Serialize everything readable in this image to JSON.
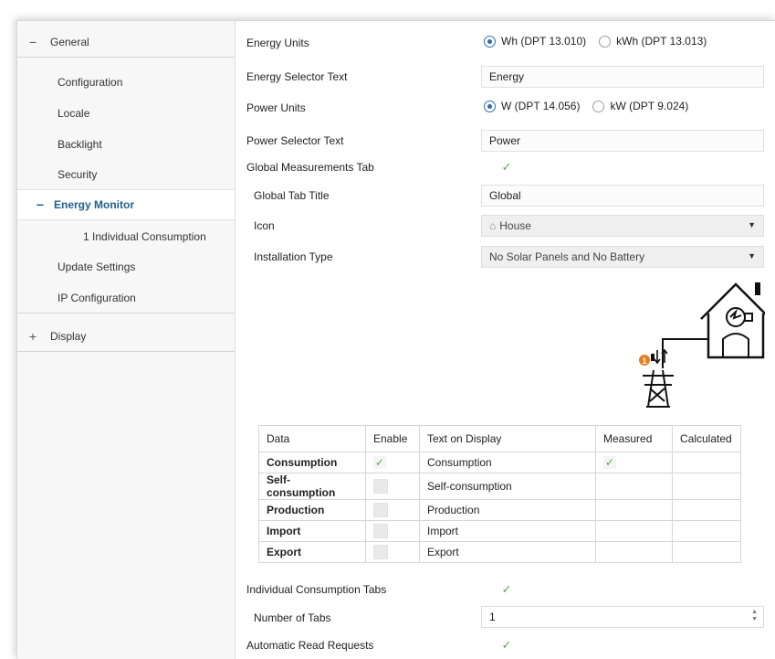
{
  "sidebar": {
    "items": [
      {
        "sign": "−",
        "label": "General"
      },
      {
        "label": "Configuration"
      },
      {
        "label": "Locale"
      },
      {
        "label": "Backlight"
      },
      {
        "label": "Security"
      },
      {
        "sign": "−",
        "label": "Energy Monitor"
      },
      {
        "label": "1 Individual Consumption"
      },
      {
        "label": "Update Settings"
      },
      {
        "label": "IP Configuration"
      },
      {
        "sign": "+",
        "label": "Display"
      }
    ]
  },
  "form": {
    "energy_units": {
      "label": "Energy Units",
      "option1": "Wh (DPT 13.010)",
      "option2": "kWh (DPT 13.013)"
    },
    "energy_selector_text": {
      "label": "Energy Selector Text",
      "value": "Energy"
    },
    "power_units": {
      "label": "Power Units",
      "option1": "W (DPT 14.056)",
      "option2": "kW (DPT 9.024)"
    },
    "power_selector_text": {
      "label": "Power Selector Text",
      "value": "Power"
    },
    "global_measurements_tab": {
      "label": "Global Measurements Tab",
      "checked": true
    },
    "global_tab_title": {
      "label": "Global Tab Title",
      "value": "Global"
    },
    "icon": {
      "label": "Icon",
      "glyph": "⌂",
      "value": "House"
    },
    "installation_type": {
      "label": "Installation Type",
      "value": "No Solar Panels and No Battery"
    },
    "individual_consumption_tabs": {
      "label": "Individual Consumption Tabs",
      "checked": true
    },
    "number_of_tabs": {
      "label": "Number of Tabs",
      "value": "1"
    },
    "automatic_read_requests": {
      "label": "Automatic Read Requests",
      "checked": true
    }
  },
  "diagram": {
    "meter_badge": "1"
  },
  "table": {
    "headers": [
      "Data",
      "Enable",
      "Text on Display",
      "Measured",
      "Calculated"
    ],
    "rows": [
      {
        "data": "Consumption",
        "enabled": true,
        "text": "Consumption",
        "measured": true
      },
      {
        "data": "Self-consumption",
        "enabled": false,
        "text": "Self-consumption",
        "measured": false
      },
      {
        "data": "Production",
        "enabled": false,
        "text": "Production",
        "measured": false
      },
      {
        "data": "Import",
        "enabled": false,
        "text": "Import",
        "measured": false
      },
      {
        "data": "Export",
        "enabled": false,
        "text": "Export",
        "measured": false
      }
    ]
  },
  "colors": {
    "accent": "#1f5f8f",
    "check": "#5aa64d",
    "badge": "#e67e22"
  }
}
